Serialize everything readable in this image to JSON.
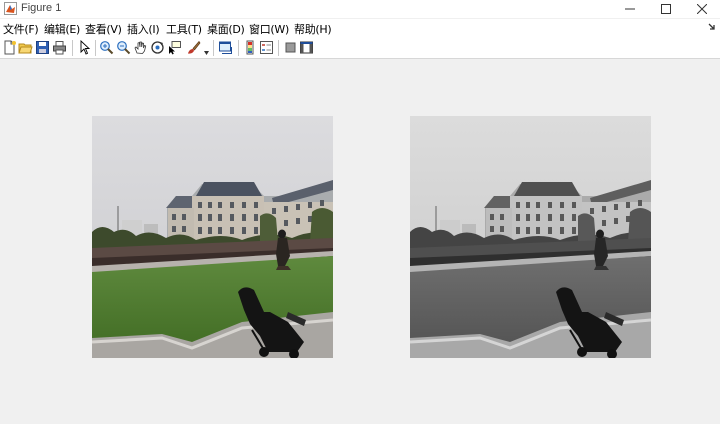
{
  "window": {
    "title": "Figure 1",
    "controls": {
      "minimize": "minimize",
      "maximize": "maximize",
      "close": "close"
    }
  },
  "menubar": {
    "items": [
      {
        "label": "文件(F)"
      },
      {
        "label": "编辑(E)"
      },
      {
        "label": "查看(V)"
      },
      {
        "label": "插入(I)"
      },
      {
        "label": "工具(T)"
      },
      {
        "label": "桌面(D)"
      },
      {
        "label": "窗口(W)"
      },
      {
        "label": "帮助(H)"
      }
    ]
  },
  "toolbar": {
    "icons": [
      "new-figure-icon",
      "open-file-icon",
      "save-icon",
      "print-icon",
      "edit-plot-icon",
      "zoom-in-icon",
      "zoom-out-icon",
      "pan-icon",
      "rotate-3d-icon",
      "data-cursor-icon",
      "brush-icon",
      "link-plot-icon",
      "insert-colorbar-icon",
      "insert-legend-icon",
      "hide-plot-tools-icon",
      "show-plot-tools-icon"
    ]
  },
  "figure": {
    "subplots": [
      {
        "name": "original-image",
        "colormode": "color"
      },
      {
        "name": "grayscale-image",
        "colormode": "grayscale"
      }
    ]
  }
}
